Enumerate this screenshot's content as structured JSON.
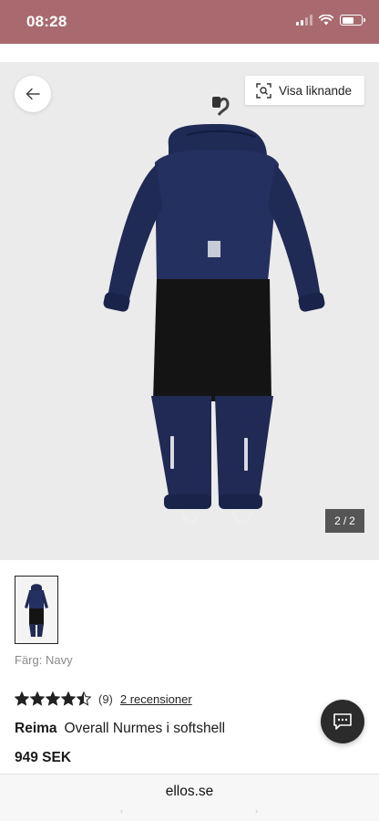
{
  "status_bar": {
    "time": "08:28",
    "icons": [
      "signal-icon",
      "wifi-icon",
      "battery-icon"
    ],
    "color": "#a86a6f"
  },
  "gallery": {
    "back_icon": "arrow-left-icon",
    "similar_button_label": "Visa liknande",
    "similar_icon": "visual-search-icon",
    "page_current": "2",
    "page_separator": "/",
    "page_total": "2",
    "background": "#ebebeb"
  },
  "product": {
    "color_label": "Färg: Navy",
    "rating_value": 4.5,
    "rating_max": 5,
    "rating_count": "(9)",
    "reviews_link": "2 recensioner",
    "brand": "Reima",
    "name": "Overall Nurmes i softshell",
    "price": "949 SEK"
  },
  "chat": {
    "icon": "chat-icon"
  },
  "browser": {
    "url": "ellos.se",
    "back_hint": "‹",
    "forward_hint": "›"
  }
}
